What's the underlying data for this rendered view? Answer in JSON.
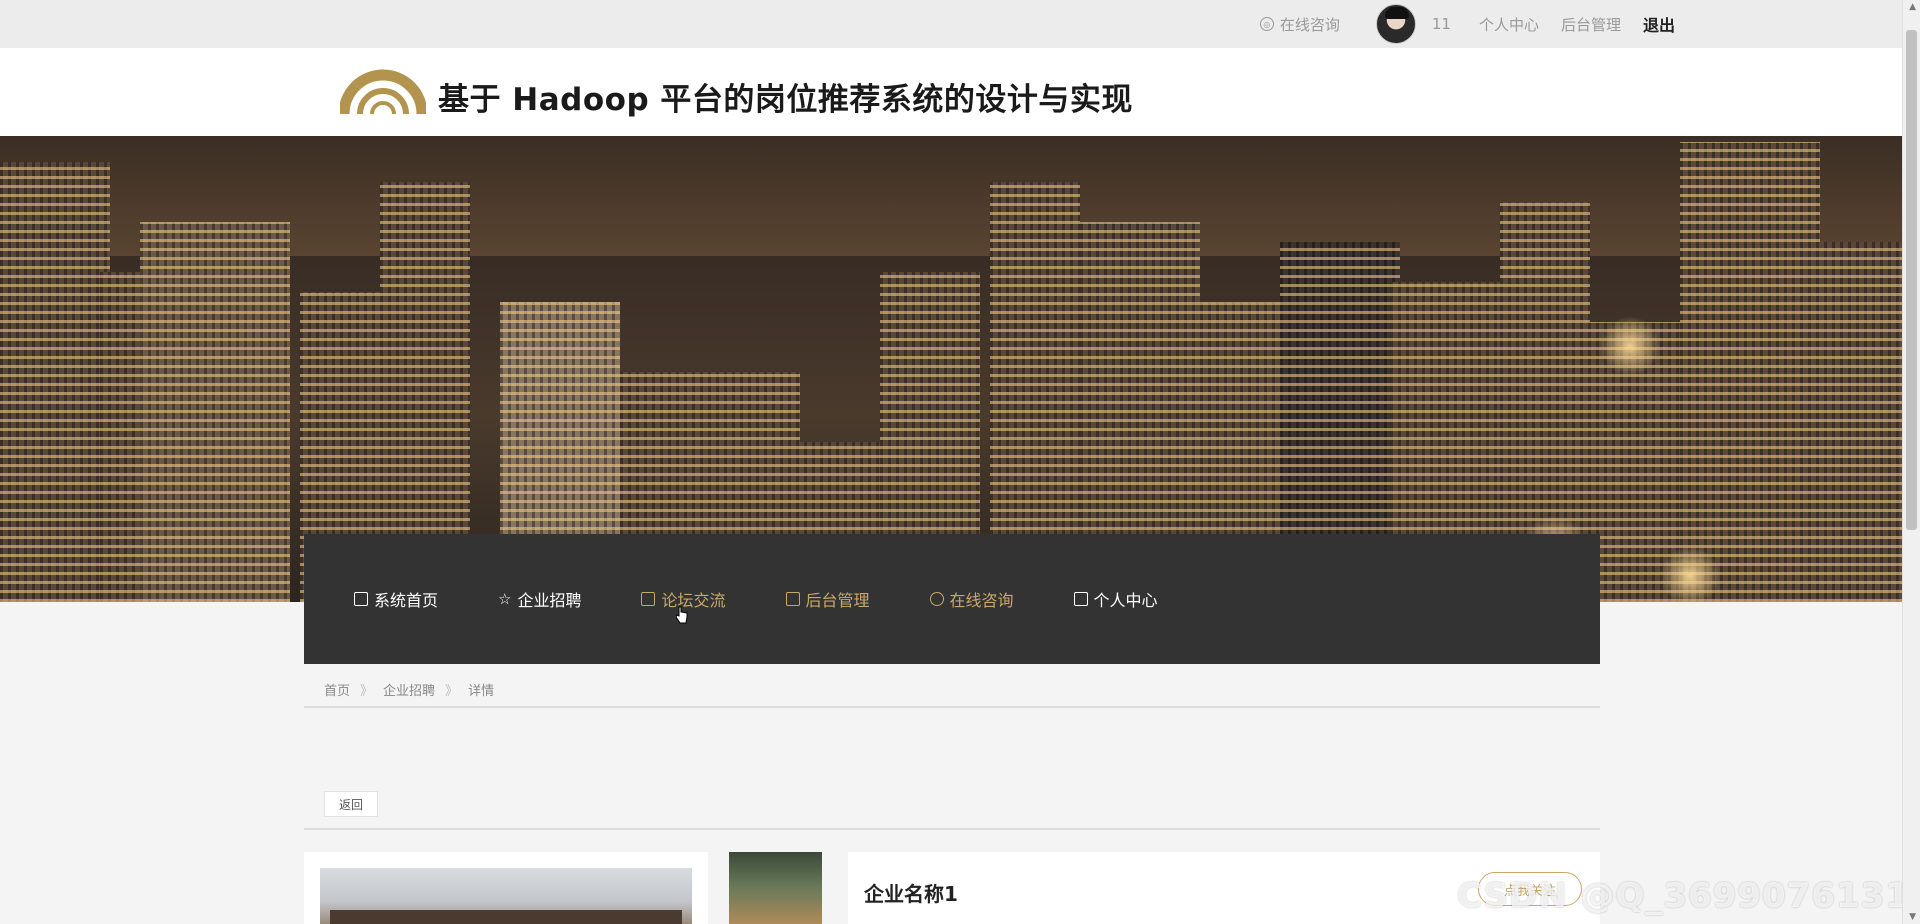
{
  "topbar": {
    "consult_label": "在线咨询",
    "username": "11",
    "personal_center": "个人中心",
    "admin": "后台管理",
    "logout": "退出"
  },
  "header": {
    "title": "基于 Hadoop 平台的岗位推荐系统的设计与实现"
  },
  "nav": {
    "items": [
      {
        "label": "系统首页",
        "icon": "home-icon"
      },
      {
        "label": "企业招聘",
        "icon": "star-icon"
      },
      {
        "label": "论坛交流",
        "icon": "bag-icon"
      },
      {
        "label": "后台管理",
        "icon": "list-icon"
      },
      {
        "label": "在线咨询",
        "icon": "user-icon"
      },
      {
        "label": "个人中心",
        "icon": "home-icon"
      }
    ]
  },
  "breadcrumb": {
    "items": [
      "首页",
      "企业招聘",
      "详情"
    ],
    "separator": "》"
  },
  "detail": {
    "back_label": "返回",
    "company_name": "企业名称1",
    "follow_label": "点我关注"
  },
  "watermark": "CSDN @Q_3699076131",
  "colors": {
    "accent": "#c9a86a",
    "nav_bg": "#333333",
    "topbar_bg": "#ececec"
  }
}
